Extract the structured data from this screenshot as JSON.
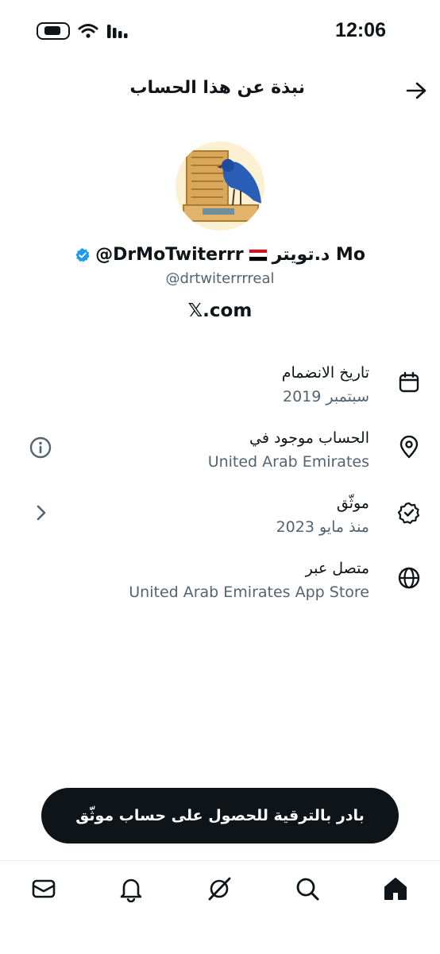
{
  "status_bar": {
    "time": "12:06"
  },
  "header": {
    "title": "نبذة عن هذا الحساب"
  },
  "profile": {
    "display_name": "د.تويتر Mo",
    "name_handle": "@DrMoTwiterrr",
    "handle": "@drtwiterrrreal",
    "website": "𝕏.com"
  },
  "info_rows": [
    {
      "title": "تاريخ الانضمام",
      "value": "سبتمبر 2019",
      "icon": "calendar-icon"
    },
    {
      "title": "الحساب موجود في",
      "value": "United Arab Emirates",
      "icon": "location-pin-icon"
    },
    {
      "title": "موثّق",
      "value": "منذ مايو 2023",
      "icon": "verified-badge-icon"
    },
    {
      "title": "متصل عبر",
      "value": "United Arab Emirates App Store",
      "icon": "globe-icon"
    }
  ],
  "upgrade_button": {
    "label": "بادر بالترقية للحصول على حساب موثّق"
  },
  "bottom_nav": [
    "mail-icon",
    "bell-icon",
    "grok-icon",
    "search-icon",
    "home-icon"
  ],
  "colors": {
    "primary_text": "#0f1419",
    "secondary_text": "#536471",
    "verified_blue": "#1d9bf0",
    "button_bg": "#0f1419"
  }
}
